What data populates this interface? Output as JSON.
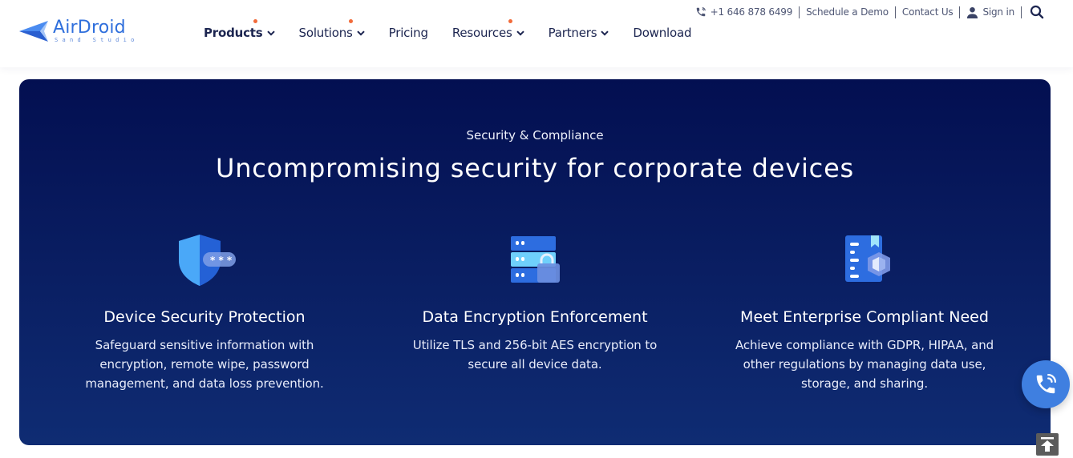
{
  "brand": {
    "name": "AirDroid",
    "tagline": "Sand Studio",
    "logo_icon": "paper-plane-logo-icon",
    "color": "#2f6fdc"
  },
  "nav": {
    "items": [
      {
        "label": "Products",
        "has_dropdown": true,
        "has_dot": true
      },
      {
        "label": "Solutions",
        "has_dropdown": true,
        "has_dot": true
      },
      {
        "label": "Pricing",
        "has_dropdown": false,
        "has_dot": false
      },
      {
        "label": "Resources",
        "has_dropdown": true,
        "has_dot": true
      },
      {
        "label": "Partners",
        "has_dropdown": true,
        "has_dot": false
      },
      {
        "label": "Download",
        "has_dropdown": false,
        "has_dot": false
      }
    ],
    "dot_color": "#f26b3a"
  },
  "utility": {
    "phone": "+1 646 878 6499",
    "phone_icon": "phone-icon",
    "schedule_demo": "Schedule a Demo",
    "contact_us": "Contact Us",
    "sign_in": "Sign in",
    "user_icon": "user-icon",
    "search_icon": "search-icon"
  },
  "hero": {
    "eyebrow": "Security & Compliance",
    "title": "Uncompromising security for corporate devices",
    "background_color": "#030f51",
    "features": [
      {
        "icon": "shield-password-icon",
        "title": "Device Security Protection",
        "description": "Safeguard sensitive information with encryption, remote wipe, password management, and data loss prevention."
      },
      {
        "icon": "server-lock-icon",
        "title": "Data Encryption Enforcement",
        "description": "Utilize TLS and 256-bit AES encryption to secure all device data."
      },
      {
        "icon": "compliance-document-icon",
        "title": "Meet Enterprise Compliant Need",
        "description": "Achieve compliance with GDPR, HIPAA, and other regulations by managing data use, storage, and sharing."
      }
    ]
  },
  "floating": {
    "call_icon": "phone-call-icon",
    "back_to_top_icon": "back-to-top-icon"
  }
}
